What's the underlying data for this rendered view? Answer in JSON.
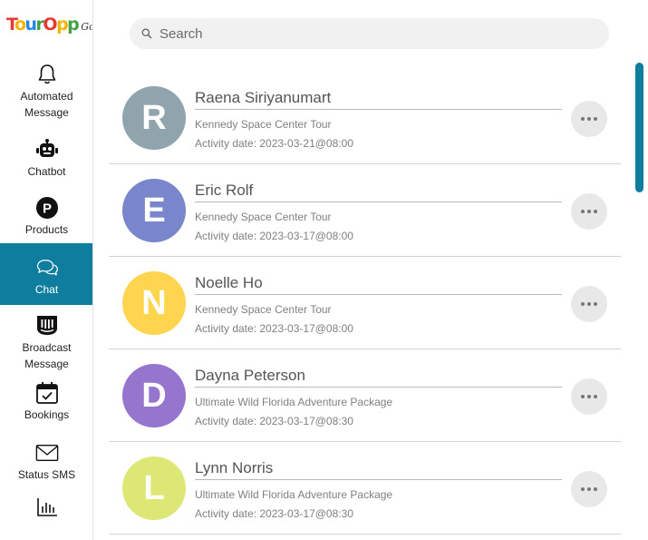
{
  "logo": {
    "letters": [
      "T",
      "o",
      "u",
      "r",
      "O",
      "p",
      "p"
    ],
    "colors": [
      "#e53935",
      "#f4b400",
      "#1e88e5",
      "#43a047",
      "#e53935",
      "#f4b400",
      "#43a047"
    ],
    "suffix": "Go!"
  },
  "sidebar": {
    "items": [
      {
        "label_line1": "Automated",
        "label_line2": "Message",
        "icon": "bell-icon"
      },
      {
        "label_line1": "Chatbot",
        "label_line2": "",
        "icon": "robot-icon"
      },
      {
        "label_line1": "Products",
        "label_line2": "",
        "icon": "products-icon",
        "icon_glyph": "P"
      },
      {
        "label_line1": "Chat",
        "label_line2": "",
        "icon": "chat-bubbles-icon",
        "active": true
      },
      {
        "label_line1": "Broadcast",
        "label_line2": "Message",
        "icon": "broadcast-icon"
      },
      {
        "label_line1": "Bookings",
        "label_line2": "",
        "icon": "calendar-check-icon"
      },
      {
        "label_line1": "Status SMS",
        "label_line2": "",
        "icon": "envelope-icon"
      },
      {
        "label_line1": "",
        "label_line2": "",
        "icon": "bar-chart-icon"
      }
    ]
  },
  "search": {
    "placeholder": "Search",
    "value": ""
  },
  "contacts": [
    {
      "initial": "R",
      "name": "Raena Siriyanumart",
      "tour": "Kennedy Space Center Tour",
      "date": "Activity date: 2023-03-21@08:00",
      "color": "#90a4ae"
    },
    {
      "initial": "E",
      "name": "Eric Rolf",
      "tour": "Kennedy Space Center Tour",
      "date": "Activity date: 2023-03-17@08:00",
      "color": "#7986cb"
    },
    {
      "initial": "N",
      "name": "Noelle Ho",
      "tour": "Kennedy Space Center Tour",
      "date": "Activity date: 2023-03-17@08:00",
      "color": "#ffd54f"
    },
    {
      "initial": "D",
      "name": "Dayna Peterson",
      "tour": "Ultimate Wild Florida Adventure Package",
      "date": "Activity date: 2023-03-17@08:30",
      "color": "#9575cd"
    },
    {
      "initial": "L",
      "name": "Lynn Norris",
      "tour": "Ultimate Wild Florida Adventure Package",
      "date": "Activity date: 2023-03-17@08:30",
      "color": "#dce775"
    }
  ],
  "accent": "#0f7e9e"
}
